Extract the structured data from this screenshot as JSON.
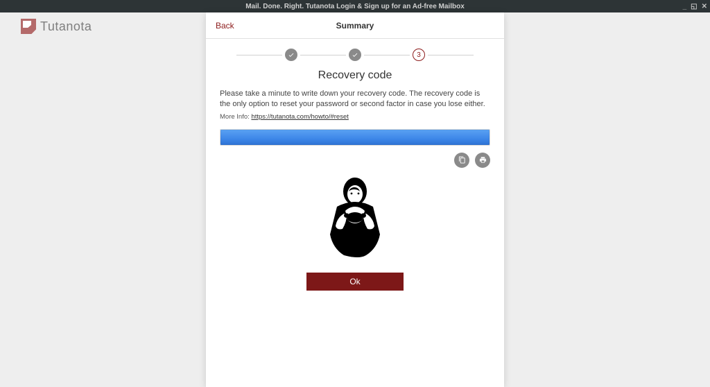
{
  "window": {
    "title": "Mail. Done. Right. Tutanota Login & Sign up for an Ad-free Mailbox"
  },
  "brand": {
    "name": "Tutanota"
  },
  "modal": {
    "back_label": "Back",
    "title": "Summary",
    "steps": {
      "current_index": 3,
      "current_label": "3"
    },
    "section_heading": "Recovery code",
    "description": "Please take a minute to write down your recovery code. The recovery code is the only option to reset your password or second factor in case you lose either.",
    "more_info_label": "More Info:",
    "more_info_link_text": "https://tutanota.com/howto/#reset",
    "actions": {
      "copy_tooltip": "Copy",
      "print_tooltip": "Print"
    },
    "ok_label": "Ok"
  },
  "colors": {
    "accent": "#8c1b1b",
    "ok_button": "#7d1818",
    "highlight": "#3d86e8"
  }
}
